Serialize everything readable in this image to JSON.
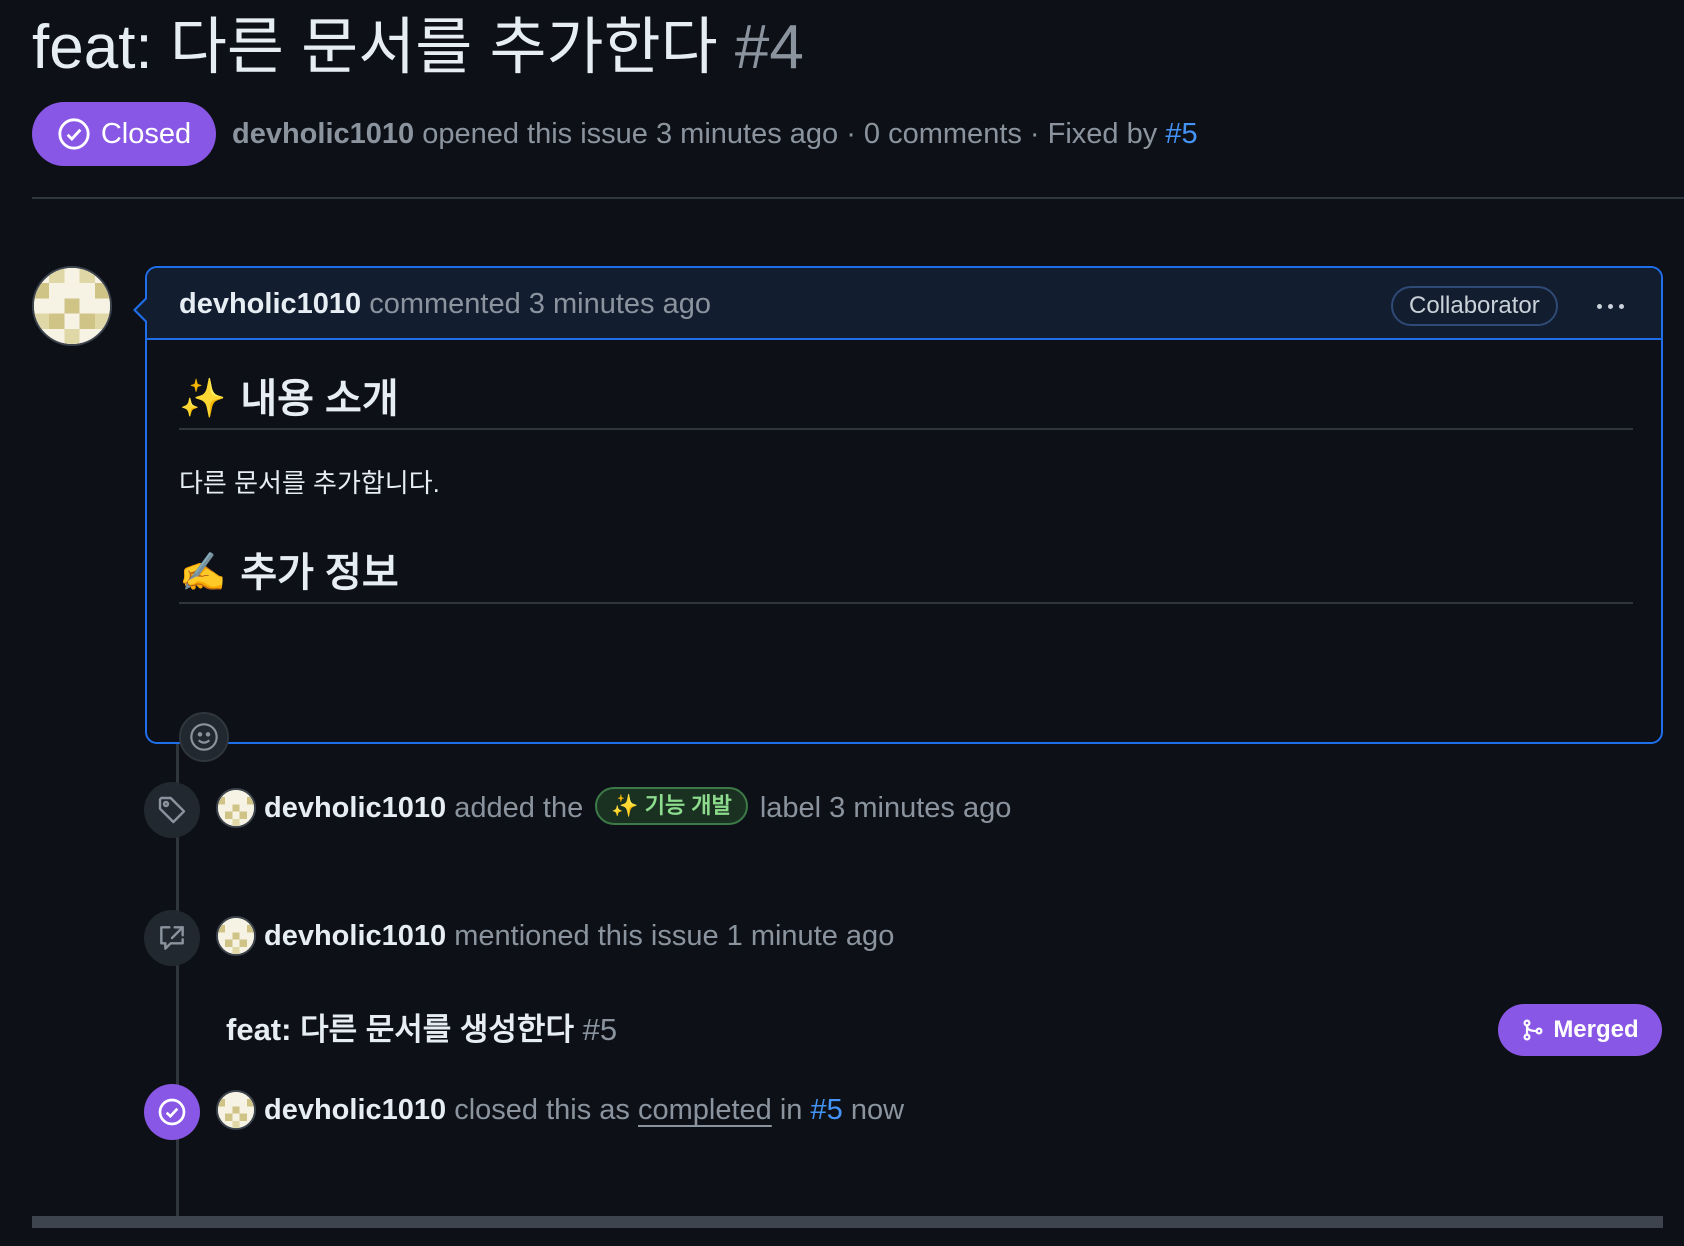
{
  "issue": {
    "title": "feat: 다른 문서를 추가한다",
    "number": "#4",
    "state": "Closed",
    "author": "devholic1010",
    "meta_opened": "opened this issue 3 minutes ago · 0 comments · Fixed by",
    "fixed_by": "#5"
  },
  "comment": {
    "author": "devholic1010",
    "action": "commented 3 minutes ago",
    "role": "Collaborator",
    "sections": [
      {
        "emoji": "✨",
        "heading": "내용 소개",
        "body": "다른 문서를 추가합니다."
      },
      {
        "emoji": "✍️",
        "heading": "추가 정보",
        "body": ""
      }
    ]
  },
  "timeline": {
    "label_event": {
      "author": "devholic1010",
      "pre": "added the",
      "label_emoji": "✨",
      "label": "기능 개발",
      "post": "label 3 minutes ago",
      "label_color": "#8ddb8c"
    },
    "mention_event": {
      "author": "devholic1010",
      "text": "mentioned this issue 1 minute ago",
      "ref_title": "feat: 다른 문서를 생성한다",
      "ref_number": "#5",
      "ref_state": "Merged"
    },
    "closed_event": {
      "author": "devholic1010",
      "pre": "closed this as",
      "reason": "completed",
      "mid": "in",
      "ref": "#5",
      "post": "now"
    }
  },
  "colors": {
    "background": "#0d1117",
    "accent_purple": "#8957e5",
    "link_blue": "#4493f8",
    "comment_border": "#1f6feb"
  },
  "icons": {
    "closed": "check-circle-icon",
    "tag": "tag-icon",
    "crossref": "cross-reference-icon",
    "merge": "git-merge-icon",
    "smiley": "smiley-icon",
    "kebab": "kebab-horizontal-icon"
  }
}
